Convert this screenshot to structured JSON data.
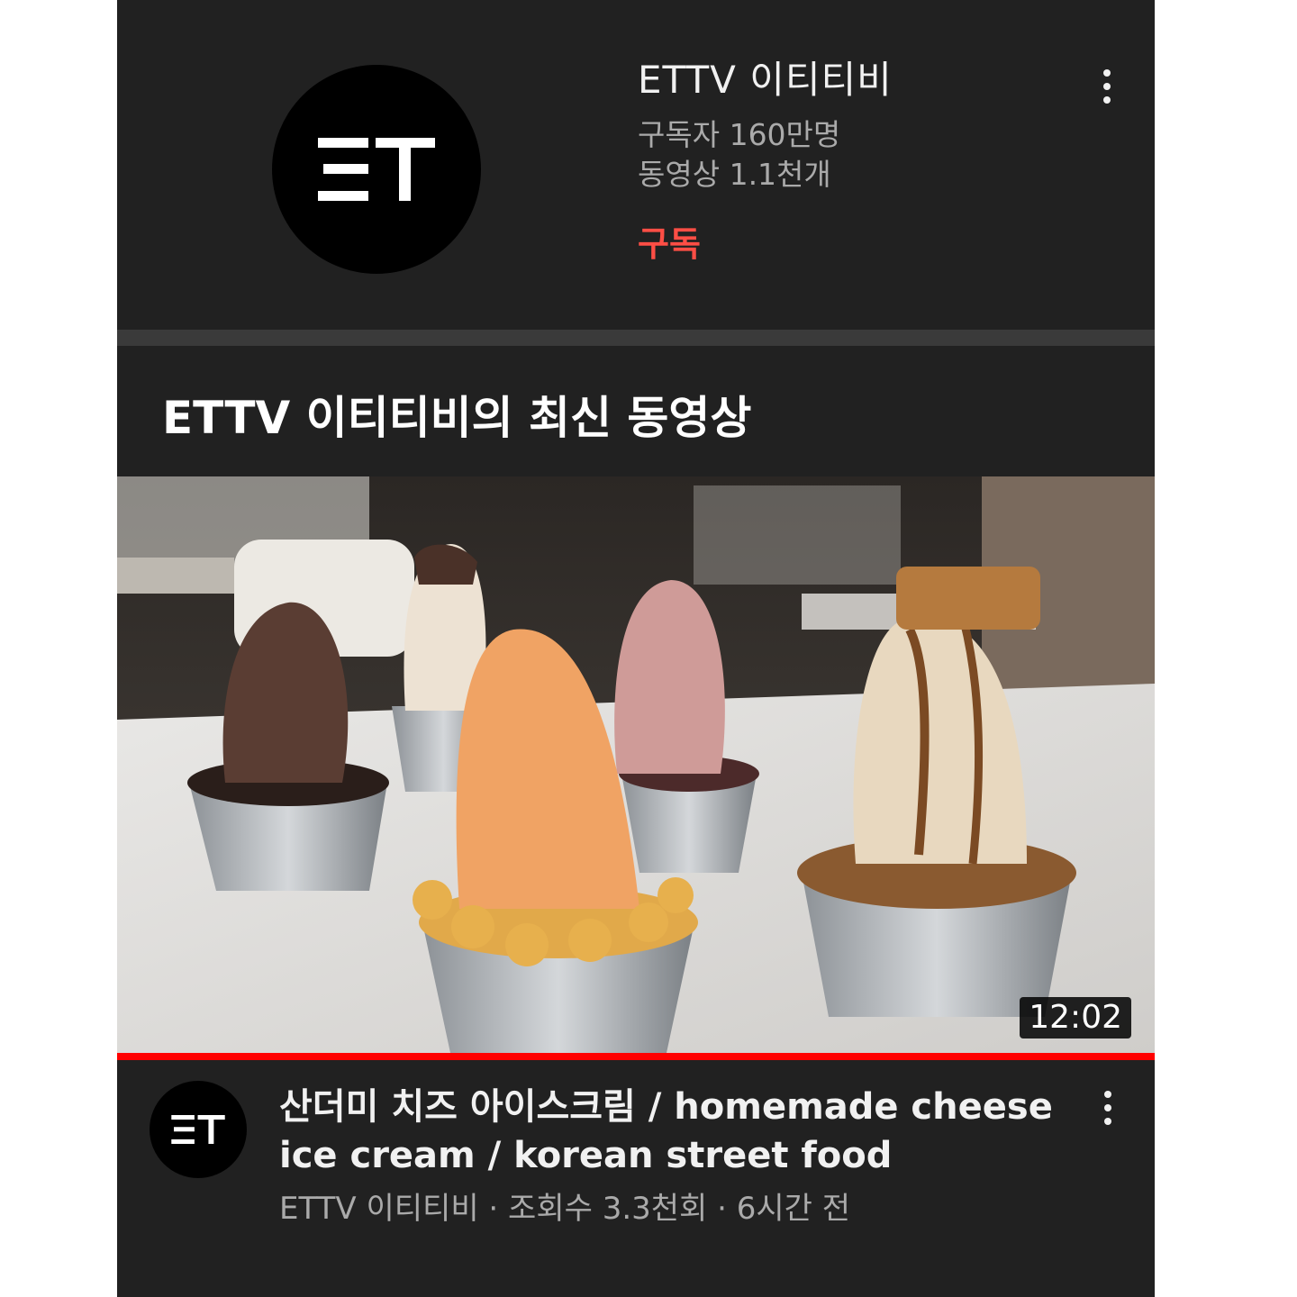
{
  "channel": {
    "name": "ETTV 이티티비",
    "subscribers": "구독자 160만명",
    "videos": "동영상 1.1천개",
    "subscribe_label": "구독",
    "logo_text": "ET"
  },
  "section": {
    "title": "ETTV 이티티비의 최신 동영상"
  },
  "video": {
    "title": "산더미 치즈 아이스크림 / homemade cheese ice cream / korean street food",
    "channel": "ETTV 이티티비",
    "views": "조회수 3.3천회",
    "age": "6시간 전",
    "separator": "·",
    "duration": "12:02",
    "watched_fraction": 1.0
  },
  "icons": {
    "channel_menu": "more-vert-icon",
    "video_menu": "more-vert-icon"
  },
  "colors": {
    "background": "#212121",
    "subscribe": "#ff4e45",
    "progress": "#ff0000",
    "secondary_text": "#aaaaaa"
  }
}
